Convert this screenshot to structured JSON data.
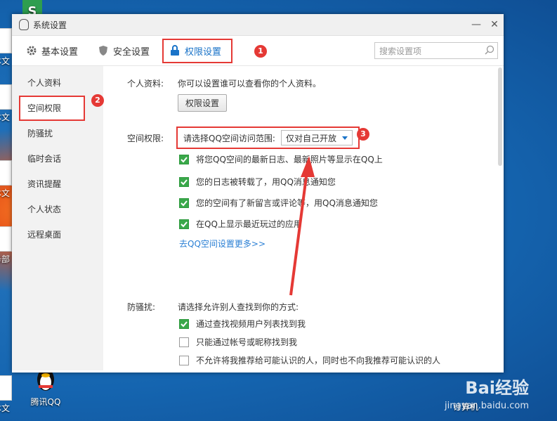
{
  "desktop": {
    "icons": [
      "本文",
      "本文",
      "本文",
      "务部",
      "本文"
    ],
    "qq_label": "腾讯QQ",
    "computer_label": "计算机",
    "watermark": "Bai经验",
    "watermark_sub": "jingyan.baidu.com"
  },
  "window": {
    "title": "系统设置",
    "minimize": "—",
    "close": "✕"
  },
  "toolbar": {
    "tabs": [
      {
        "label": "基本设置",
        "icon": "gear-icon"
      },
      {
        "label": "安全设置",
        "icon": "shield-icon"
      },
      {
        "label": "权限设置",
        "icon": "lock-icon"
      }
    ],
    "search_placeholder": "搜索设置项"
  },
  "sidebar": {
    "items": [
      {
        "label": "个人资料"
      },
      {
        "label": "空间权限"
      },
      {
        "label": "防骚扰"
      },
      {
        "label": "临时会话"
      },
      {
        "label": "资讯提醒"
      },
      {
        "label": "个人状态"
      },
      {
        "label": "远程桌面"
      }
    ]
  },
  "content": {
    "profile_label": "个人资料:",
    "profile_desc": "你可以设置谁可以查看你的个人资料。",
    "profile_button": "权限设置",
    "space_label": "空间权限:",
    "space_prompt": "请选择QQ空间访问范围:",
    "space_select": "仅对自己开放",
    "space_checks": [
      {
        "label": "将您QQ空间的最新日志、最新照片等显示在QQ上",
        "checked": true
      },
      {
        "label": "您的日志被转载了，用QQ消息通知您",
        "checked": true
      },
      {
        "label": "您的空间有了新留言或评论等，用QQ消息通知您",
        "checked": true
      },
      {
        "label": "在QQ上显示最近玩过的应用",
        "checked": true
      }
    ],
    "space_link": "去QQ空间设置更多>>",
    "harass_label": "防骚扰:",
    "harass_prompt": "请选择允许别人查找到你的方式:",
    "harass_checks": [
      {
        "label": "通过查找视频用户列表找到我",
        "checked": true
      },
      {
        "label": "只能通过帐号或昵称找到我",
        "checked": false
      },
      {
        "label": "不允许将我推荐给可能认识的人，同时也不向我推荐可能认识的人",
        "checked": false
      }
    ]
  },
  "annotations": [
    "1",
    "2",
    "3"
  ],
  "colors": {
    "accent": "#1a73c8",
    "highlight": "#e53935",
    "check": "#3aa84a"
  }
}
